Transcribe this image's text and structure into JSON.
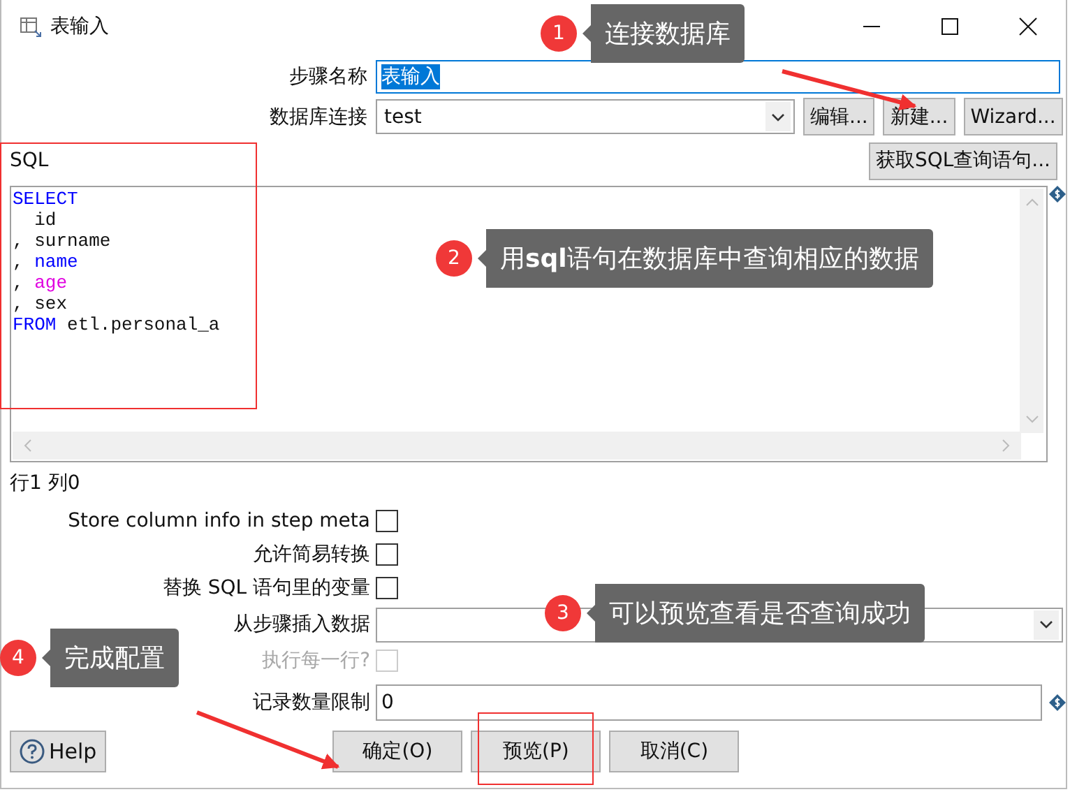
{
  "window": {
    "title": "表输入"
  },
  "step_name": {
    "label": "步骤名称",
    "value": "表输入",
    "selected": true
  },
  "connection": {
    "label": "数据库连接",
    "value": "test",
    "buttons": [
      "编辑...",
      "新建...",
      "Wizard..."
    ]
  },
  "sql": {
    "label": "SQL",
    "button": "获取SQL查询语句...",
    "lines": [
      [
        {
          "text": "SELECT",
          "kind": "keyword"
        }
      ],
      [
        {
          "text": "  id",
          "kind": "plain"
        }
      ],
      [
        {
          "text": ", surname",
          "kind": "plain"
        }
      ],
      [
        {
          "text": ", ",
          "kind": "plain"
        },
        {
          "text": "name",
          "kind": "keyword"
        }
      ],
      [
        {
          "text": ", ",
          "kind": "plain"
        },
        {
          "text": "age",
          "kind": "function"
        }
      ],
      [
        {
          "text": ", sex",
          "kind": "plain"
        }
      ],
      [
        {
          "text": "FROM",
          "kind": "keyword"
        },
        {
          "text": " etl.personal_a",
          "kind": "plain"
        }
      ]
    ]
  },
  "position": "行1 列0",
  "fields": [
    {
      "kind": "checkbox",
      "label": "Store column info in step meta",
      "checked": false,
      "disabled": false
    },
    {
      "kind": "checkbox",
      "label": "允许简易转换",
      "checked": false,
      "disabled": false
    },
    {
      "kind": "checkbox",
      "label": "替换 SQL 语句里的变量",
      "checked": false,
      "disabled": false
    },
    {
      "kind": "combo",
      "label": "从步骤插入数据"
    },
    {
      "kind": "checkbox",
      "label": "执行每一行?",
      "checked": false,
      "disabled": true
    },
    {
      "kind": "input",
      "label": "记录数量限制",
      "value": "0"
    }
  ],
  "buttons": [
    {
      "kind": "help",
      "label": "Help"
    },
    {
      "kind": "plain",
      "label": "确定(O)"
    },
    {
      "kind": "plain",
      "label": "预览(P)"
    },
    {
      "kind": "plain",
      "label": "取消(C)"
    }
  ],
  "annotations": [
    {
      "number": "1",
      "text": "连接数据库"
    },
    {
      "number": "2",
      "text": "用**sql**语句在数据库中查询相应的数据"
    },
    {
      "number": "3",
      "text": "可以预览查看是否查询成功"
    },
    {
      "number": "4",
      "text": "完成配置"
    }
  ]
}
